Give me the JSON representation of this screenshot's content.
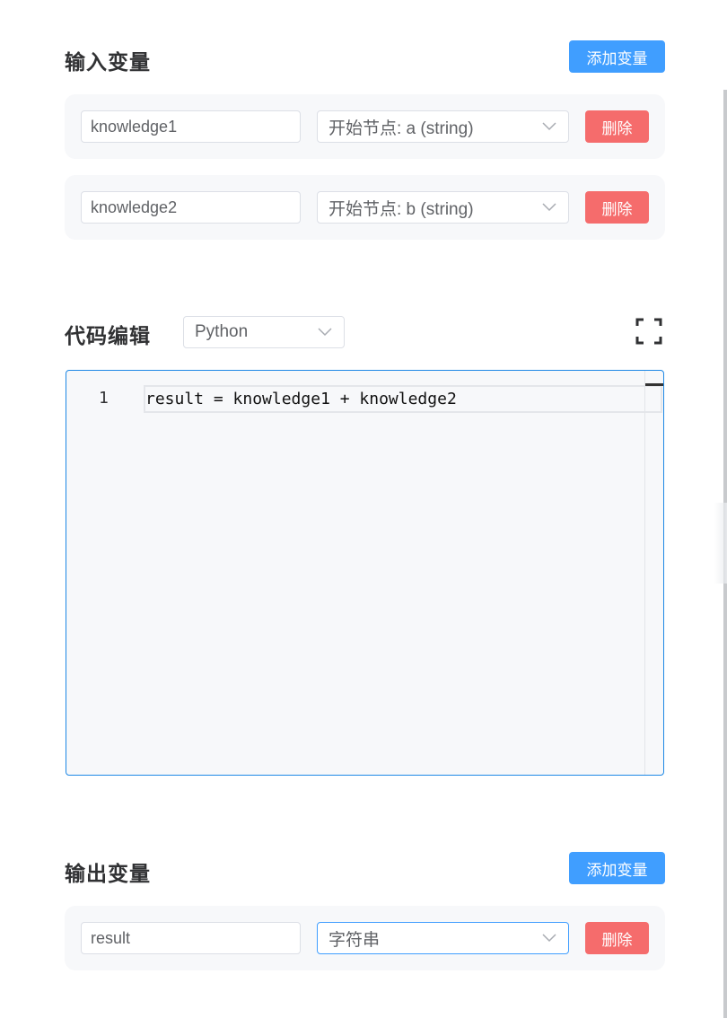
{
  "input_section": {
    "title": "输入变量",
    "add_label": "添加变量",
    "rows": [
      {
        "name": "knowledge1",
        "source": "开始节点: a (string)",
        "delete_label": "删除"
      },
      {
        "name": "knowledge2",
        "source": "开始节点: b (string)",
        "delete_label": "删除"
      }
    ]
  },
  "code_section": {
    "title": "代码编辑",
    "language": "Python",
    "line_number": "1",
    "code": "result = knowledge1 + knowledge2"
  },
  "output_section": {
    "title": "输出变量",
    "add_label": "添加变量",
    "rows": [
      {
        "name": "result",
        "type": "字符串",
        "delete_label": "删除"
      }
    ]
  },
  "colors": {
    "primary": "#409eff",
    "danger": "#f56c6c",
    "card_bg": "#f7f8fa",
    "editor_border": "#1e88e5"
  }
}
